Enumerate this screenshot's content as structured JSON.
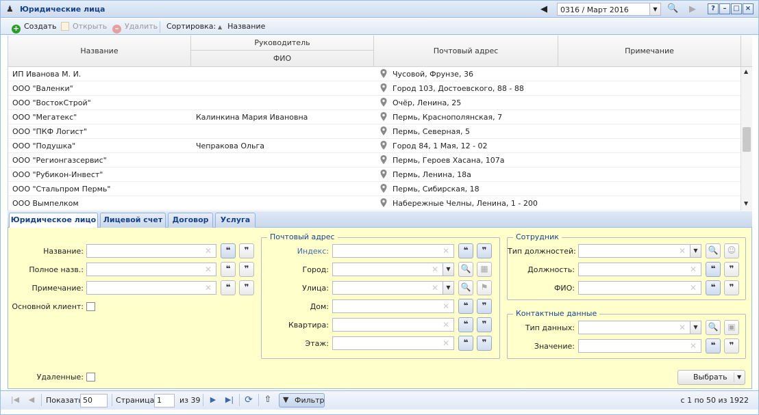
{
  "window": {
    "title": "Юридические лица"
  },
  "period": {
    "value": "0316 / Март 2016"
  },
  "titlebar_buttons": [
    "?",
    "–",
    "□",
    "×"
  ],
  "toolbar": {
    "create": "Создать",
    "open": "Открыть",
    "delete": "Удалить",
    "sort_label": "Сортировка:",
    "sort_value": "Название"
  },
  "grid": {
    "headers": {
      "name": "Название",
      "manager": "Руководитель",
      "fio": "ФИО",
      "address": "Почтовый адрес",
      "note": "Примечание"
    },
    "rows": [
      {
        "name": "ИП Иванова М. И.",
        "fio": "",
        "address": "Чусовой, Фрунзе, 36"
      },
      {
        "name": "ООО \"Валенки\"",
        "fio": "",
        "address": "Город 103, Достоевского, 88 - 88"
      },
      {
        "name": "ООО \"ВостокСтрой\"",
        "fio": "",
        "address": "Очёр, Ленина, 25"
      },
      {
        "name": "ООО \"Мегатекс\"",
        "fio": "Калинкина Мария Ивановна",
        "address": "Пермь, Краснополянская, 7"
      },
      {
        "name": "ООО \"ПКФ Логист\"",
        "fio": "",
        "address": "Пермь, Северная, 5"
      },
      {
        "name": "ООО \"Подушка\"",
        "fio": "Чепракова Ольга",
        "address": "Город 84, 1 Мая, 12 - 02"
      },
      {
        "name": "ООО \"Регионгазсервис\"",
        "fio": "",
        "address": "Пермь, Героев Хасана, 107а"
      },
      {
        "name": "ООО \"Рубикон-Инвест\"",
        "fio": "",
        "address": "Пермь, Ленина, 18а"
      },
      {
        "name": "ООО \"Стальпром Пермь\"",
        "fio": "",
        "address": "Пермь, Сибирская, 18"
      },
      {
        "name": "ООО Вымпелком",
        "fio": "",
        "address": "Набережные Челны, Ленина, 1 - 200"
      }
    ]
  },
  "tabs": [
    "Юридическое лицо",
    "Лицевой счет",
    "Договор",
    "Услуга"
  ],
  "form": {
    "name_label": "Название:",
    "fullname_label": "Полное назв.:",
    "note_label": "Примечание:",
    "main_client_label": "Основной клиент:",
    "deleted_label": "Удаленные:",
    "postal_legend": "Почтовый адрес",
    "index_label": "Индекс:",
    "city_label": "Город:",
    "street_label": "Улица:",
    "house_label": "Дом:",
    "flat_label": "Квартира:",
    "floor_label": "Этаж:",
    "employee_legend": "Сотрудник",
    "pos_type_label": "Тип должностей:",
    "position_label": "Должность:",
    "fio_label": "ФИО:",
    "contacts_legend": "Контактные данные",
    "data_type_label": "Тип данных:",
    "value_label": "Значение:",
    "select_button": "Выбрать"
  },
  "pager": {
    "show_label": "Показать",
    "page_size": "50",
    "page_label": "Страница",
    "page": "1",
    "of_pages": "из 39",
    "filter": "Фильтр",
    "summary": "с 1 по 50 из 1922"
  }
}
